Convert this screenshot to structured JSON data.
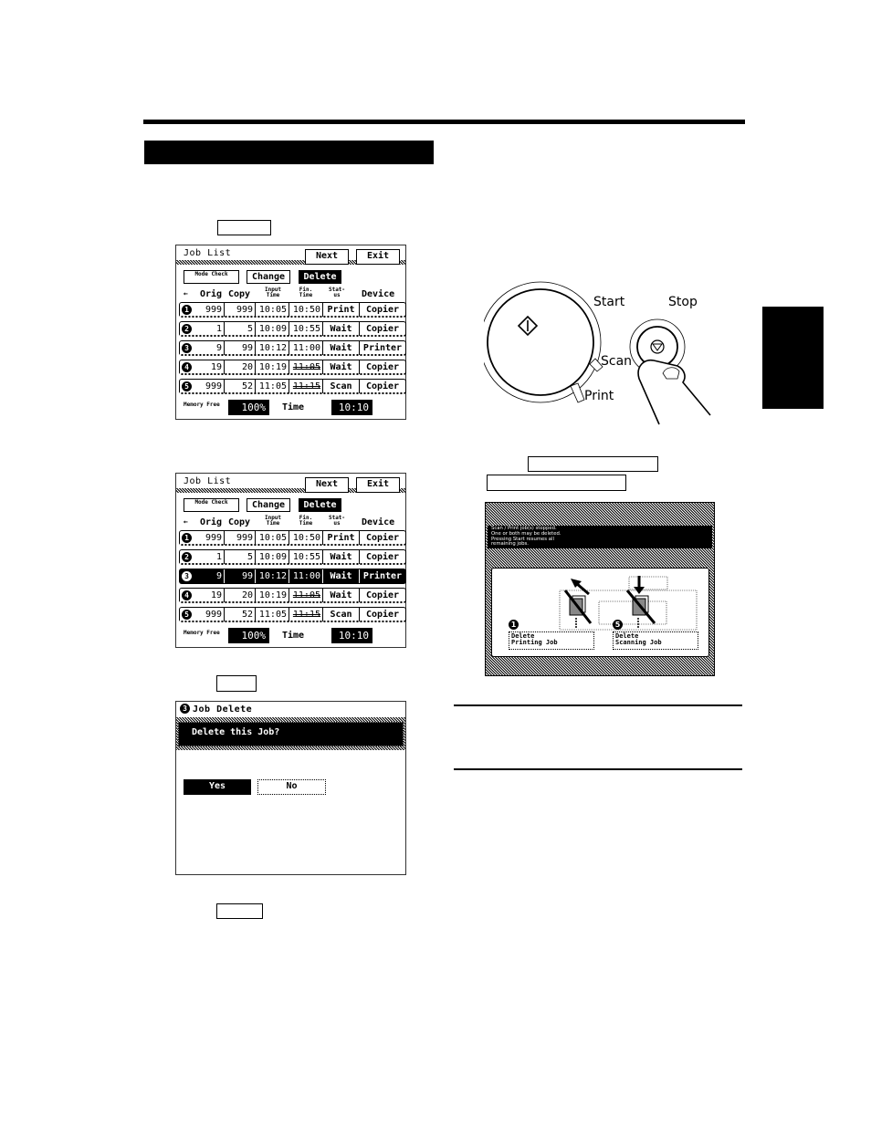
{
  "page": {
    "heading": "",
    "side_tab": ""
  },
  "key_labels": {
    "step1_key": "",
    "step2_key": "",
    "step3_key": "",
    "right_key_1": "",
    "right_key_2": ""
  },
  "job_list": {
    "title": "Job List",
    "next_label": "Next",
    "exit_label": "Exit",
    "mode_check_label": "Mode Check",
    "change_label": "Change",
    "delete_label": "Delete",
    "columns": {
      "marker": "←",
      "orig": "Orig",
      "copy": "Copy",
      "input_time": "Input Time",
      "fin_time": "Fin. Time",
      "status": "Stat- us",
      "device": "Device"
    },
    "rows": [
      {
        "no": "1",
        "orig": "999",
        "copy": "999",
        "input": "10:05",
        "fin": "10:50",
        "fin_struck": false,
        "status": "Print",
        "device": "Copier"
      },
      {
        "no": "2",
        "orig": "1",
        "copy": "5",
        "input": "10:09",
        "fin": "10:55",
        "fin_struck": false,
        "status": "Wait",
        "device": "Copier"
      },
      {
        "no": "3",
        "orig": "9",
        "copy": "99",
        "input": "10:12",
        "fin": "11:00",
        "fin_struck": false,
        "status": "Wait",
        "device": "Printer"
      },
      {
        "no": "4",
        "orig": "19",
        "copy": "20",
        "input": "10:19",
        "fin": "11:05",
        "fin_struck": true,
        "status": "Wait",
        "device": "Copier"
      },
      {
        "no": "5",
        "orig": "999",
        "copy": "52",
        "input": "11:05",
        "fin": "11:15",
        "fin_struck": true,
        "status": "Scan",
        "device": "Copier"
      }
    ],
    "memory_free_label": "Memory Free",
    "memory_free_value": "100%",
    "time_label": "Time",
    "time_value": "10:10",
    "selected_row_second_screen": 3
  },
  "job_delete": {
    "job_number": "3",
    "title": "Job Delete",
    "message": "Delete this Job?",
    "yes_label": "Yes",
    "no_label": "No"
  },
  "control_panel": {
    "start_label": "Start",
    "stop_label": "Stop",
    "scan_label": "Scan",
    "print_label": "Print"
  },
  "stopped_screen": {
    "message_lines": [
      "Scan / Print job(s) stopped.",
      "One or both may be deleted.",
      "Pressing Start resumes all",
      "remaining jobs."
    ],
    "delete_printing_number": "1",
    "delete_printing_label_1": "Delete",
    "delete_printing_label_2": "Printing Job",
    "delete_scanning_number": "5",
    "delete_scanning_label_1": "Delete",
    "delete_scanning_label_2": "Scanning Job"
  }
}
